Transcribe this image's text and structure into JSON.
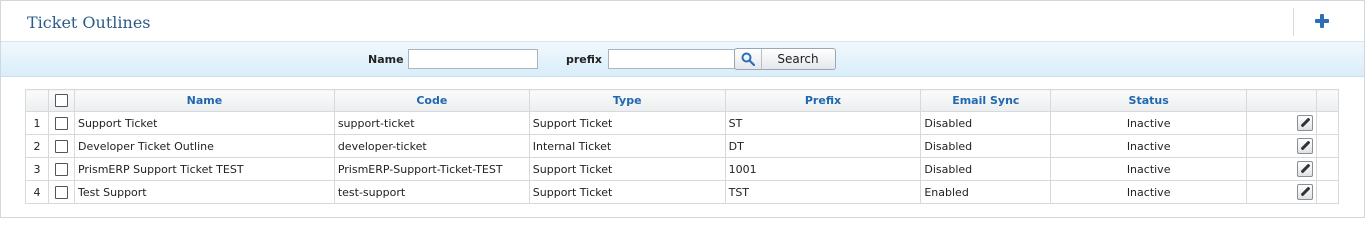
{
  "header": {
    "title": "Ticket Outlines",
    "add_icon": "plus-icon"
  },
  "search": {
    "name_label": "Name",
    "name_value": "",
    "prefix_label": "prefix",
    "prefix_value": "",
    "button_label": "Search",
    "button_icon": "magnifier-icon"
  },
  "table": {
    "columns": [
      "Name",
      "Code",
      "Type",
      "Prefix",
      "Email Sync",
      "Status"
    ],
    "rows": [
      {
        "num": "1",
        "name": "Support Ticket",
        "code": "support-ticket",
        "type": "Support Ticket",
        "prefix": "ST",
        "email_sync": "Disabled",
        "status": "Inactive"
      },
      {
        "num": "2",
        "name": "Developer Ticket Outline",
        "code": "developer-ticket",
        "type": "Internal Ticket",
        "prefix": "DT",
        "email_sync": "Disabled",
        "status": "Inactive"
      },
      {
        "num": "3",
        "name": "PrismERP Support Ticket TEST",
        "code": "PrismERP-Support-Ticket-TEST",
        "type": "Support Ticket",
        "prefix": "1001",
        "email_sync": "Disabled",
        "status": "Inactive"
      },
      {
        "num": "4",
        "name": "Test Support",
        "code": "test-support",
        "type": "Support Ticket",
        "prefix": "TST",
        "email_sync": "Enabled",
        "status": "Inactive"
      }
    ]
  },
  "colors": {
    "accent": "#2b5c8a",
    "link": "#1f68b0",
    "toolbar_bg": "#d9edf9"
  }
}
